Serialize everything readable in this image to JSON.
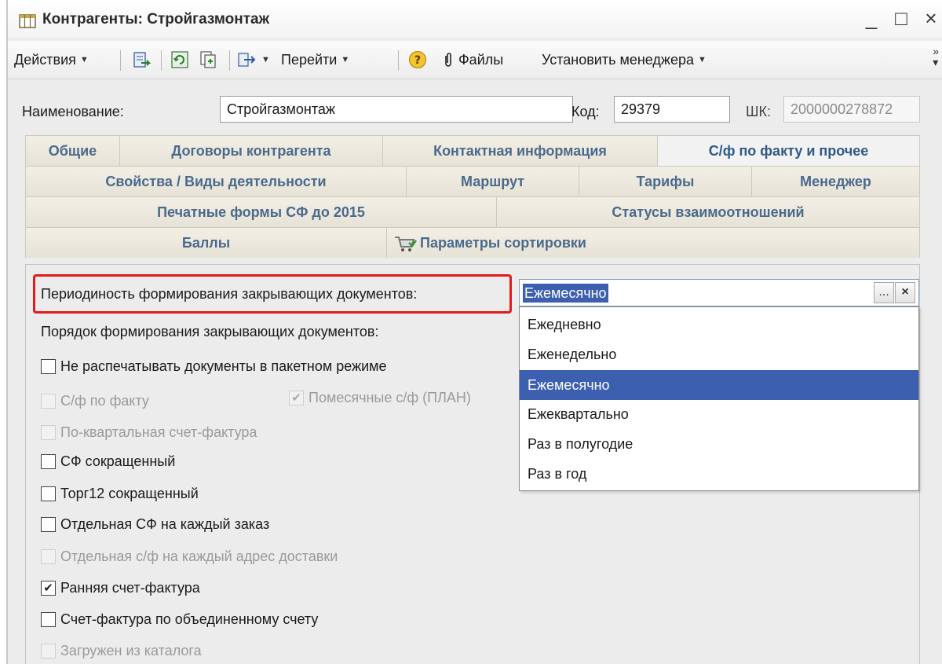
{
  "window": {
    "title": "Контрагенты: Стройгазмонтаж",
    "controls": [
      "_",
      "□",
      "×"
    ]
  },
  "toolbar": {
    "actions": "Действия",
    "goto": "Перейти",
    "files": "Файлы",
    "set_manager": "Установить менеджера",
    "icons": [
      "save-close-icon",
      "refresh-icon",
      "copy-icon",
      "goto-arrow-icon",
      "help-icon",
      "paperclip-icon"
    ]
  },
  "header": {
    "name_label": "Наименование:",
    "name_value": "Стройгазмонтаж",
    "code_label": "Код:",
    "code_value": "29379",
    "barcode_label": "ШК:",
    "barcode_value": "2000000278872"
  },
  "tabs": {
    "row1": [
      "Общие",
      "Договоры контрагента",
      "Контактная информация",
      "С/ф по факту и прочее"
    ],
    "row2": [
      "Свойства / Виды деятельности",
      "Маршрут",
      "Тарифы",
      "Менеджер"
    ],
    "row3": [
      "Печатные формы СФ до 2015",
      "Статусы взаимоотношений"
    ],
    "row4": [
      "Баллы",
      "Параметры сортировки"
    ],
    "active": "С/ф по факту и прочее"
  },
  "form": {
    "periodicity_label": "Периодиность формирования закрывающих документов:",
    "periodicity_value": "Ежемесячно",
    "order_label": "Порядок формирования закрывающих документов:",
    "dropdown_options": [
      "Ежедневно",
      "Еженедельно",
      "Ежемесячно",
      "Ежеквартально",
      "Раз в полугодие",
      "Раз в год"
    ],
    "dropdown_selected": "Ежемесячно",
    "select_button": "...",
    "clear_button": "×"
  },
  "checkboxes": [
    {
      "label": "Не распечатывать документы в пакетном режиме",
      "checked": false,
      "disabled": false
    },
    {
      "label": "С/ф по факту",
      "checked": false,
      "disabled": true
    },
    {
      "label": "Помесячные с/ф (ПЛАН)",
      "checked": true,
      "disabled": true
    },
    {
      "label": "По-квартальная счет-фактура",
      "checked": false,
      "disabled": true
    },
    {
      "label": "СФ сокращенный",
      "checked": false,
      "disabled": false
    },
    {
      "label": "Торг12 сокращенный",
      "checked": false,
      "disabled": false
    },
    {
      "label": "Отдельная СФ на каждый заказ",
      "checked": false,
      "disabled": false
    },
    {
      "label": "Отдельная с/ф на каждый адрес доставки",
      "checked": false,
      "disabled": true
    },
    {
      "label": "Ранняя счет-фактура",
      "checked": true,
      "disabled": false
    },
    {
      "label": "Счет-фактура по объединенному счету",
      "checked": false,
      "disabled": false
    },
    {
      "label": "Загружен из каталога",
      "checked": false,
      "disabled": true
    }
  ],
  "colors": {
    "highlight": "#e21b1b",
    "selection": "#3d5fb0",
    "tab_text": "#4a6a8c"
  }
}
